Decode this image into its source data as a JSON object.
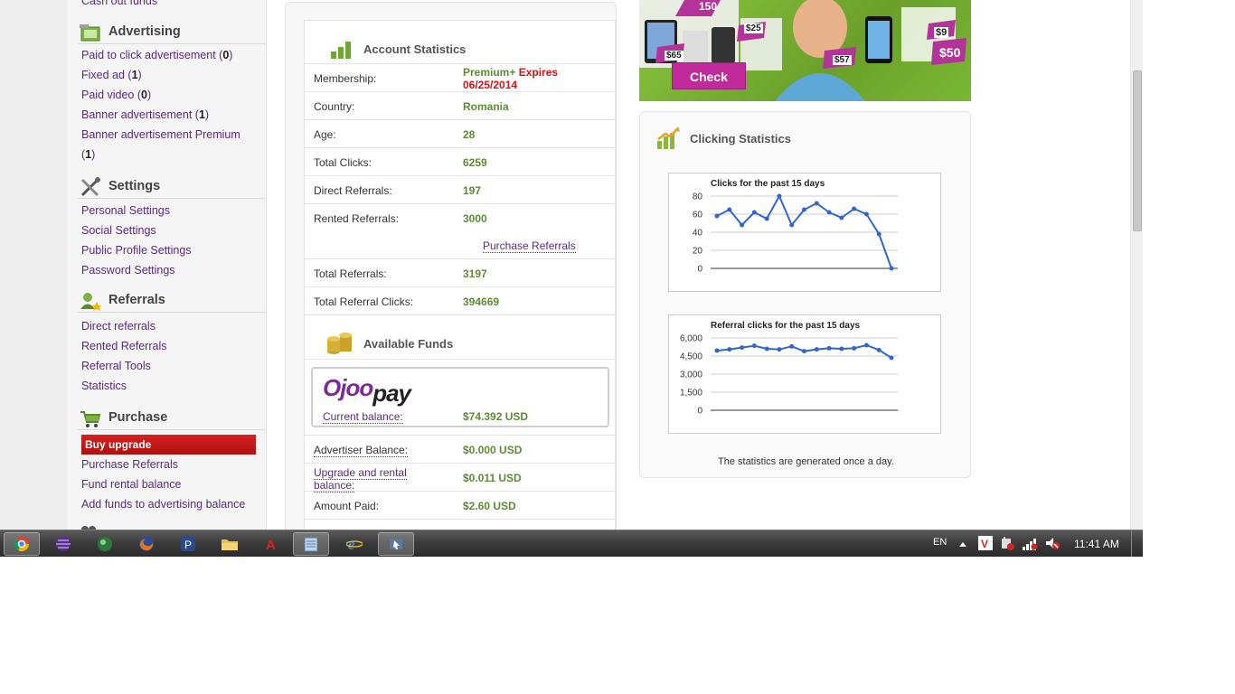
{
  "sidebar": {
    "top_cut_link": "Cash out funds",
    "advertising": {
      "title": "Advertising",
      "items": [
        {
          "label": "Paid to click advertisement",
          "count": "0"
        },
        {
          "label": "Fixed ad",
          "count": "1"
        },
        {
          "label": "Paid video",
          "count": "0"
        },
        {
          "label": "Banner advertisement",
          "count": "1"
        },
        {
          "label": "Banner advertisement Premium",
          "count": "1"
        }
      ]
    },
    "settings": {
      "title": "Settings",
      "items": [
        "Personal Settings",
        "Social Settings",
        "Public Profile Settings",
        "Password Settings"
      ]
    },
    "referrals": {
      "title": "Referrals",
      "items": [
        "Direct referrals",
        "Rented Referrals",
        "Referral Tools",
        "Statistics"
      ]
    },
    "purchase": {
      "title": "Purchase",
      "buy_upgrade": "Buy upgrade",
      "items": [
        "Purchase Referrals",
        "Fund rental balance",
        "Add funds to advertising balance"
      ]
    }
  },
  "account": {
    "title": "Account Statistics",
    "membership_label": "Membership:",
    "membership_value": "Premium+",
    "membership_expires": "Expires",
    "membership_date": "06/25/2014",
    "rows": [
      {
        "label": "Country:",
        "value": "Romania"
      },
      {
        "label": "Age:",
        "value": "28"
      },
      {
        "label": "Total Clicks:",
        "value": "6259"
      },
      {
        "label": "Direct Referrals:",
        "value": "197"
      },
      {
        "label": "Rented Referrals:",
        "value": "3000"
      }
    ],
    "purchase_referrals_link": "Purchase Referrals",
    "rows2": [
      {
        "label": "Total Referrals:",
        "value": "3197"
      },
      {
        "label": "Total Referral Clicks:",
        "value": "394669"
      }
    ]
  },
  "funds": {
    "title": "Available Funds",
    "ojoo_logo_a": "Ojoo",
    "ojoo_logo_b": "pay",
    "current_balance_label": "Current balance:",
    "current_balance_value": "$74.392 USD",
    "advertiser_label": "Advertiser Balance:",
    "advertiser_value": "$0.000 USD",
    "upgrade_label_1": "Upgrade and rental",
    "upgrade_label_2": "balance:",
    "upgrade_value": "$0.011 USD",
    "amount_paid_label": "Amount Paid:",
    "amount_paid_value": "$2.60 USD"
  },
  "banner": {
    "check_label": "Check",
    "prices": [
      "150",
      "$25",
      "$65",
      "$57",
      "$9",
      "$50"
    ]
  },
  "clicking": {
    "title": "Clicking Statistics",
    "note": "The statistics are generated once a day."
  },
  "chart_data": [
    {
      "type": "line",
      "title": "Clicks for the past 15 days",
      "x": [
        1,
        2,
        3,
        4,
        5,
        6,
        7,
        8,
        9,
        10,
        11,
        12,
        13,
        14,
        15
      ],
      "values": [
        58,
        65,
        48,
        62,
        55,
        80,
        48,
        65,
        72,
        62,
        56,
        66,
        60,
        38,
        0
      ],
      "ylim": [
        0,
        80
      ],
      "yticks": [
        "80",
        "60",
        "40",
        "20",
        "0"
      ],
      "line_color": "#3366cc"
    },
    {
      "type": "line",
      "title": "Referral clicks for the past 15 days",
      "x": [
        1,
        2,
        3,
        4,
        5,
        6,
        7,
        8,
        9,
        10,
        11,
        12,
        13,
        14,
        15
      ],
      "values": [
        4950,
        5050,
        5200,
        5350,
        5100,
        5050,
        5300,
        4900,
        5050,
        5150,
        5100,
        5150,
        5400,
        5000,
        4350
      ],
      "ylim": [
        0,
        6000
      ],
      "yticks": [
        "6,000",
        "4,500",
        "3,000",
        "1,500",
        "0"
      ],
      "line_color": "#3366cc"
    }
  ],
  "taskbar": {
    "lang": "EN",
    "time": "11:41 AM"
  }
}
